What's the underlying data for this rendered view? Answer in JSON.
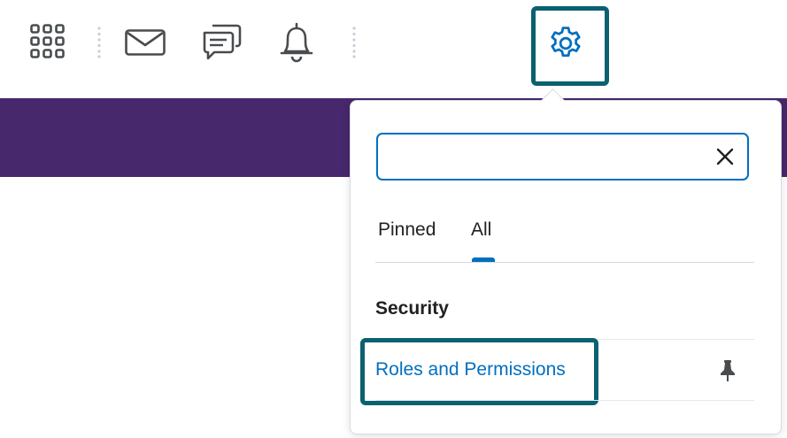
{
  "navbar": {
    "icons": [
      "waffle-icon",
      "email-icon",
      "message-icon",
      "bell-icon",
      "gear-icon"
    ],
    "brand_color": "#47286c",
    "highlight_color": "#0a6170"
  },
  "settings_menu": {
    "search": {
      "value": "",
      "placeholder": ""
    },
    "tabs": [
      {
        "label": "Pinned",
        "selected": false
      },
      {
        "label": "All",
        "selected": true
      }
    ],
    "accent_color": "#006fbf",
    "sections": [
      {
        "heading": "Security",
        "items": [
          {
            "label": "Roles and Permissions",
            "pin_icon": "pin-icon"
          }
        ]
      }
    ]
  }
}
